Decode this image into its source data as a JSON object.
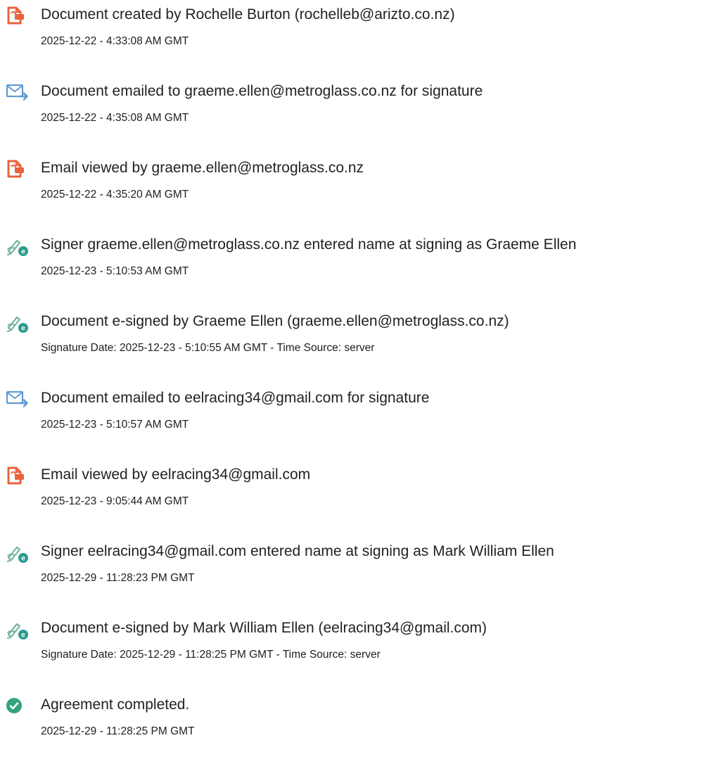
{
  "events": [
    {
      "icon": "document-created-icon",
      "title": "Document created by Rochelle Burton (rochelleb@arizto.co.nz)",
      "time": "2025-12-22 - 4:33:08 AM GMT"
    },
    {
      "icon": "email-sent-icon",
      "title": "Document emailed to graeme.ellen@metroglass.co.nz for signature",
      "time": "2025-12-22 - 4:35:08 AM GMT"
    },
    {
      "icon": "document-viewed-icon",
      "title": "Email viewed by graeme.ellen@metroglass.co.nz",
      "time": "2025-12-22 - 4:35:20 AM GMT"
    },
    {
      "icon": "e-signature-icon",
      "title": "Signer graeme.ellen@metroglass.co.nz entered name at signing as Graeme Ellen",
      "time": "2025-12-23 - 5:10:53 AM GMT"
    },
    {
      "icon": "e-signature-icon",
      "title": "Document e-signed by Graeme Ellen (graeme.ellen@metroglass.co.nz)",
      "time": "Signature Date: 2025-12-23 - 5:10:55 AM GMT - Time Source: server"
    },
    {
      "icon": "email-sent-icon",
      "title": "Document emailed to eelracing34@gmail.com for signature",
      "time": "2025-12-23 - 5:10:57 AM GMT"
    },
    {
      "icon": "document-viewed-icon",
      "title": "Email viewed by eelracing34@gmail.com",
      "time": "2025-12-23 - 9:05:44 AM GMT"
    },
    {
      "icon": "e-signature-icon",
      "title": "Signer eelracing34@gmail.com entered name at signing as Mark William Ellen",
      "time": "2025-12-29 - 11:28:23 PM GMT"
    },
    {
      "icon": "e-signature-icon",
      "title": "Document e-signed by Mark William Ellen (eelracing34@gmail.com)",
      "time": "Signature Date: 2025-12-29 - 11:28:25 PM GMT - Time Source: server"
    },
    {
      "icon": "agreement-completed-icon",
      "title": "Agreement completed.",
      "time": "2025-12-29 - 11:28:25 PM GMT"
    }
  ],
  "colors": {
    "doc_icon": "#e8623c",
    "email_icon": "#5f9ad6",
    "sign_pen": "#76b39d",
    "sign_badge": "#2a9d8f",
    "completed": "#33a37c"
  }
}
